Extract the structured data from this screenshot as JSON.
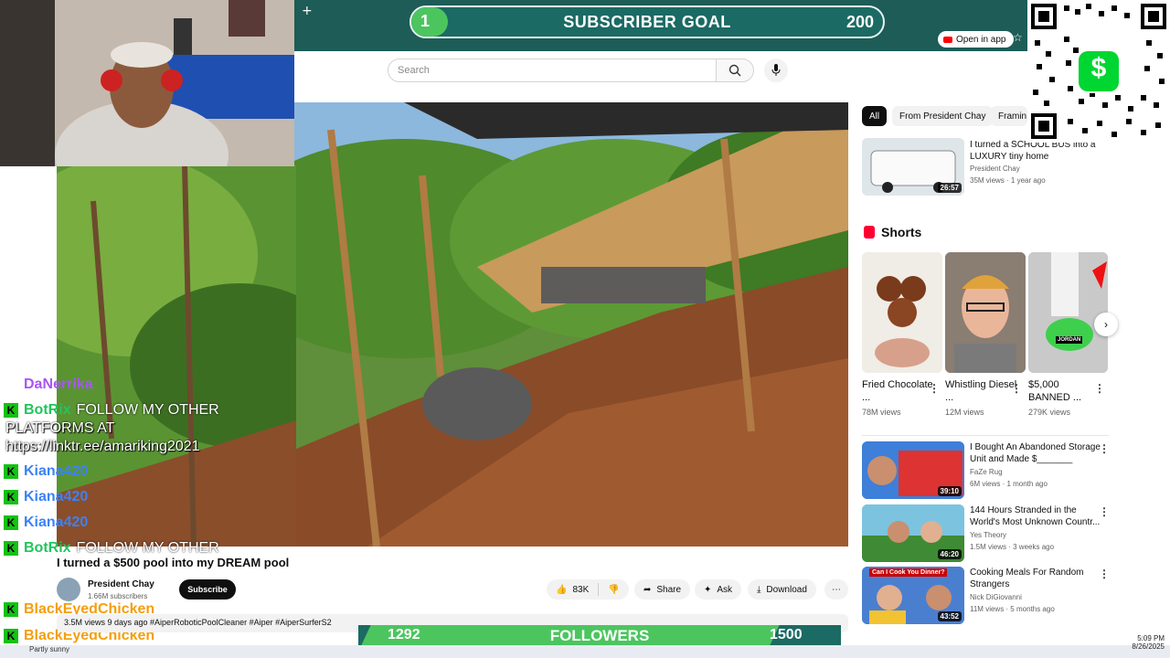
{
  "overlay": {
    "subscriber_goal": {
      "current": "1",
      "label": "SUBSCRIBER GOAL",
      "target": "200",
      "progress": 0.005
    },
    "followers_goal": {
      "current": "1292",
      "label": "FOLLOWERS",
      "target": "1500",
      "progress": 0.86
    },
    "plus": "+"
  },
  "browser": {
    "open_in_app": "Open in app",
    "star": "☆"
  },
  "search": {
    "placeholder": "Search"
  },
  "video": {
    "title": "I turned a $500 pool into my DREAM pool",
    "channel": "President Chay",
    "subscribers": "1.66M subscribers",
    "subscribe_label": "Subscribe",
    "likes": "83K",
    "share_label": "Share",
    "ask_label": "Ask",
    "download_label": "Download",
    "meta": "3.5M views  9 days ago  #AiperRoboticPoolCleaner #Aiper #AiperSurferS2"
  },
  "chat": [
    {
      "user": "DaNerrika",
      "text": ""
    },
    {
      "user": "BotRix",
      "text": "FOLLOW MY OTHER"
    },
    {
      "user": "",
      "text": "PLATFORMS AT"
    },
    {
      "user": "",
      "text": "https://linktr.ee/amariking2021"
    },
    {
      "user": "Kiana420",
      "text": ""
    },
    {
      "user": "Kiana420",
      "text": ""
    },
    {
      "user": "Kiana420",
      "text": ""
    },
    {
      "user": "BotRix",
      "text": "FOLLOW MY OTHER"
    },
    {
      "user": "BlackEyedChicken",
      "text": ""
    },
    {
      "user": "BlackEyedChicken",
      "text": ""
    }
  ],
  "chat_colors": {
    "botrix": "#22c55e",
    "kiana": "#3b82f6",
    "chicken": "#f59e0b",
    "danerrika": "#a855f7"
  },
  "sidebar": {
    "chips": [
      "All",
      "From President Chay",
      "Framin"
    ],
    "first_video": {
      "title": "I turned a SCHOOL BUS into a LUXURY tiny home",
      "channel": "President Chay",
      "meta": "35M views · 1 year ago",
      "duration": "26:57"
    },
    "shorts_heading": "Shorts",
    "shorts": [
      {
        "title": "Fried Chocolate ...",
        "views": "78M views"
      },
      {
        "title": "Whistling Diesel ...",
        "views": "12M views"
      },
      {
        "title": "$5,000 BANNED ...",
        "views": "279K views",
        "badge": "JORDAN"
      }
    ],
    "videos": [
      {
        "title": "I Bought An Abandoned Storage Unit and Made $_______",
        "channel": "FaZe Rug",
        "meta": "6M views · 1 month ago",
        "duration": "39:10"
      },
      {
        "title": "144 Hours Stranded in the World's Most Unknown Countr...",
        "channel": "Yes Theory",
        "meta": "1.5M views · 3 weeks ago",
        "duration": "46:20"
      },
      {
        "title": "Cooking Meals For Random Strangers",
        "channel": "Nick DiGiovanni",
        "meta": "11M views · 5 months ago",
        "duration": "43:52",
        "thumb_text": "Can I Cook You Dinner?"
      }
    ]
  },
  "taskbar": {
    "weather": "Partly sunny",
    "time": "5:09 PM",
    "date": "8/26/2025"
  },
  "cashapp": {
    "symbol": "$"
  }
}
